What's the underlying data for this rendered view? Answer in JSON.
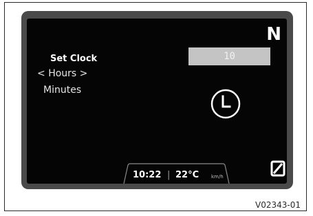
{
  "display": {
    "gear_indicator": "N",
    "menu": {
      "title": "Set Clock",
      "selected_item": "Hours",
      "prev_arrow": "<",
      "next_arrow": ">",
      "item_2": "Minutes"
    },
    "value_field": "10",
    "center_icon": "clock-icon",
    "status_bar": {
      "time": "10:22",
      "separator": "|",
      "temperature": "22°C",
      "speed_unit": "km/h"
    },
    "corner_icon": "slashed-zero-icon"
  },
  "reference_code": "V02343-01",
  "colors": {
    "screen_bg": "#050505",
    "device_bezel": "#4a4a4a",
    "value_box_bg": "#c4c4c4",
    "text": "#ffffff"
  }
}
